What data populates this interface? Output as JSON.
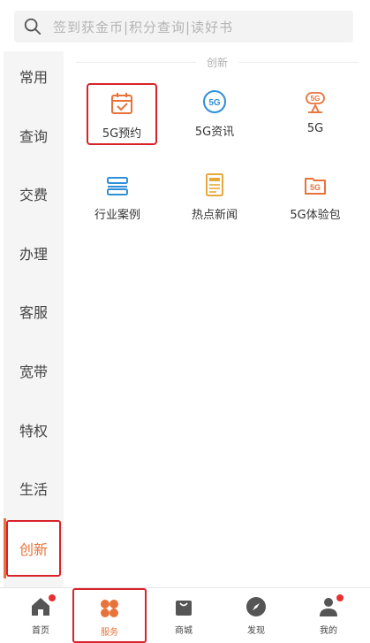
{
  "search": {
    "placeholder": "签到获金币|积分查询|读好书"
  },
  "sidebar": {
    "items": [
      {
        "label": "常用"
      },
      {
        "label": "查询"
      },
      {
        "label": "交费"
      },
      {
        "label": "办理"
      },
      {
        "label": "客服"
      },
      {
        "label": "宽带"
      },
      {
        "label": "特权"
      },
      {
        "label": "生活"
      },
      {
        "label": "创新"
      }
    ],
    "active_index": 8
  },
  "section": {
    "title": "创新",
    "tiles": [
      {
        "label": "5G预约",
        "icon": "calendar-check-icon"
      },
      {
        "label": "5G资讯",
        "icon": "5g-circle-icon"
      },
      {
        "label": "5G",
        "icon": "5g-signal-icon"
      },
      {
        "label": "行业案例",
        "icon": "stacked-tray-icon"
      },
      {
        "label": "热点新闻",
        "icon": "newspaper-icon"
      },
      {
        "label": "5G体验包",
        "icon": "5g-folder-icon"
      }
    ]
  },
  "tabbar": {
    "items": [
      {
        "label": "首页",
        "icon": "home-icon",
        "badge": true
      },
      {
        "label": "服务",
        "icon": "flower-grid-icon",
        "badge": false
      },
      {
        "label": "商城",
        "icon": "shopping-bag-icon",
        "badge": false
      },
      {
        "label": "发现",
        "icon": "compass-icon",
        "badge": false
      },
      {
        "label": "我的",
        "icon": "user-icon",
        "badge": true
      }
    ],
    "active_index": 1
  },
  "colors": {
    "accent": "#e8733a",
    "highlight_border": "#d8232a",
    "blue": "#2f8fd8",
    "badge": "#e8302f"
  }
}
